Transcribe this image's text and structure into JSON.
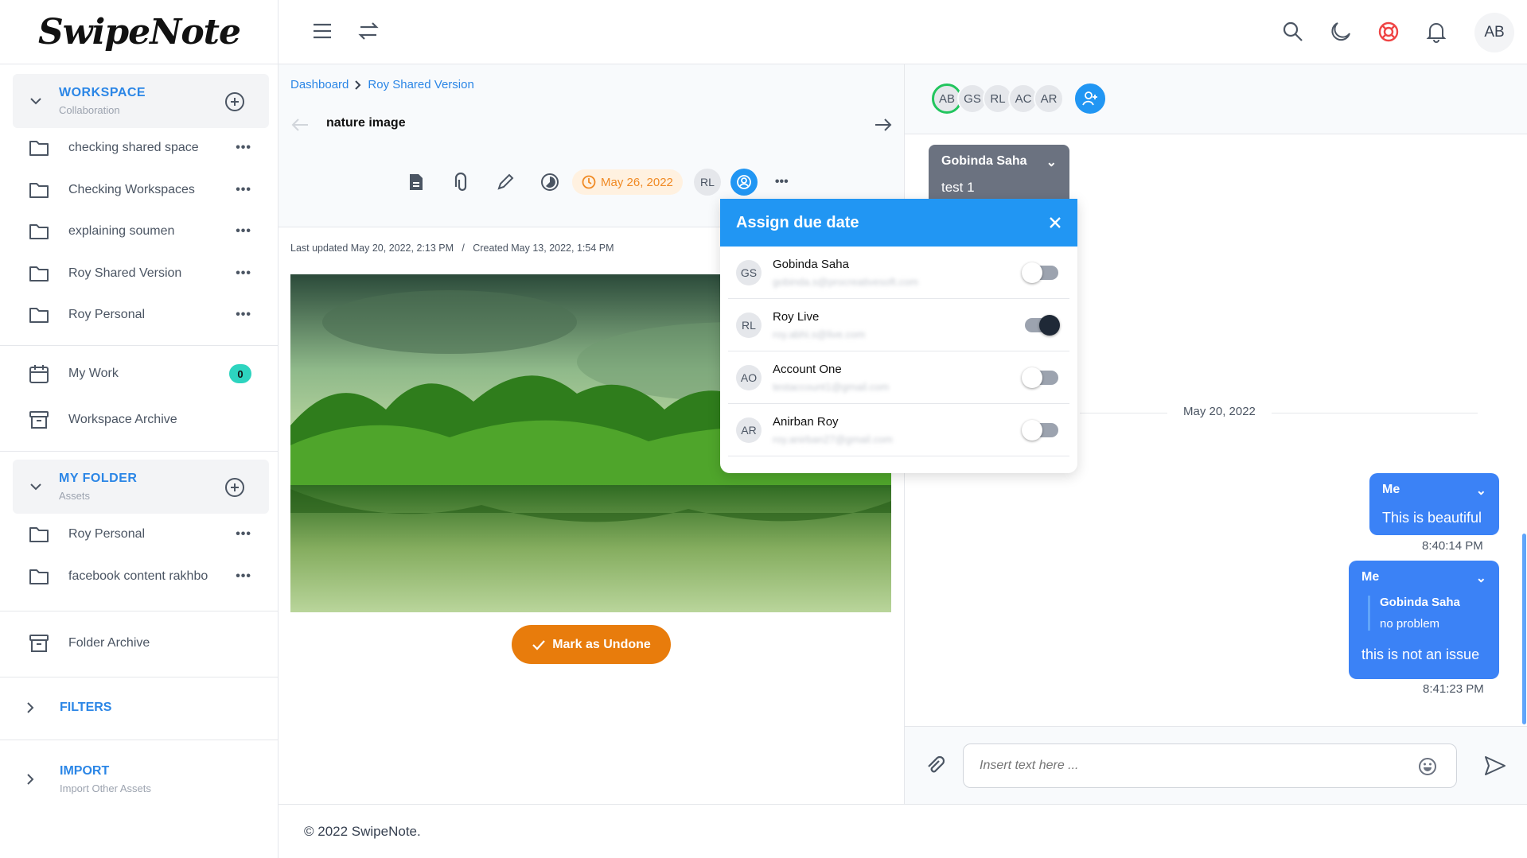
{
  "app": {
    "logo": "SwipeNote",
    "user_initials": "AB",
    "footer": "© 2022 SwipeNote."
  },
  "sidebar": {
    "workspace": {
      "title": "WORKSPACE",
      "subtitle": "Collaboration",
      "items": [
        "checking shared space",
        "Checking Workspaces",
        "explaining soumen",
        "Roy Shared Version",
        "Roy Personal"
      ]
    },
    "my_work": {
      "label": "My Work",
      "badge": "0"
    },
    "workspace_archive": "Workspace Archive",
    "my_folder": {
      "title": "MY FOLDER",
      "subtitle": "Assets",
      "items": [
        "Roy Personal",
        "facebook content rakhbo"
      ]
    },
    "folder_archive": "Folder Archive",
    "filters": "FILTERS",
    "import": {
      "title": "IMPORT",
      "subtitle": "Import Other Assets"
    },
    "more_label": "•••"
  },
  "note": {
    "breadcrumb": [
      "Dashboard",
      "Roy Shared Version"
    ],
    "title": "nature image",
    "due_date": "May 26, 2022",
    "assignee_initials": "RL",
    "more": "•••",
    "meta": "Last updated May 20, 2022, 2:13 PM   /   Created May 13, 2022, 1:54 PM",
    "mark_button": "Mark as Undone"
  },
  "chat": {
    "members": [
      "AB",
      "GS",
      "RL",
      "AC",
      "AR"
    ],
    "pinned": {
      "author": "Gobinda Saha",
      "text": "test 1"
    },
    "date_divider": "May 20, 2022",
    "messages": [
      {
        "author": "Me",
        "text": "This is beautiful",
        "time": "8:40:14 PM"
      },
      {
        "author": "Me",
        "quote_author": "Gobinda Saha",
        "quote_text": "no problem",
        "text": "this is not an issue",
        "time": "8:41:23 PM"
      }
    ],
    "input_placeholder": "Insert text here ..."
  },
  "popup": {
    "title": "Assign due date",
    "users": [
      {
        "initials": "GS",
        "name": "Gobinda Saha",
        "email": "gobinda.s@procreativesoft.com",
        "on": false
      },
      {
        "initials": "RL",
        "name": "Roy Live",
        "email": "roy.abhi.s@live.com",
        "on": true
      },
      {
        "initials": "AO",
        "name": "Account One",
        "email": "testaccount1@gmail.com",
        "on": false
      },
      {
        "initials": "AR",
        "name": "Anirban Roy",
        "email": "roy.anirban27@gmail.com",
        "on": false
      }
    ]
  },
  "colors": {
    "accent": "#2196f3",
    "bubble": "#3b82f6",
    "mark_button": "#e87c0c",
    "badge": "#2dd4bf",
    "due_pill": "#fff1e0"
  }
}
